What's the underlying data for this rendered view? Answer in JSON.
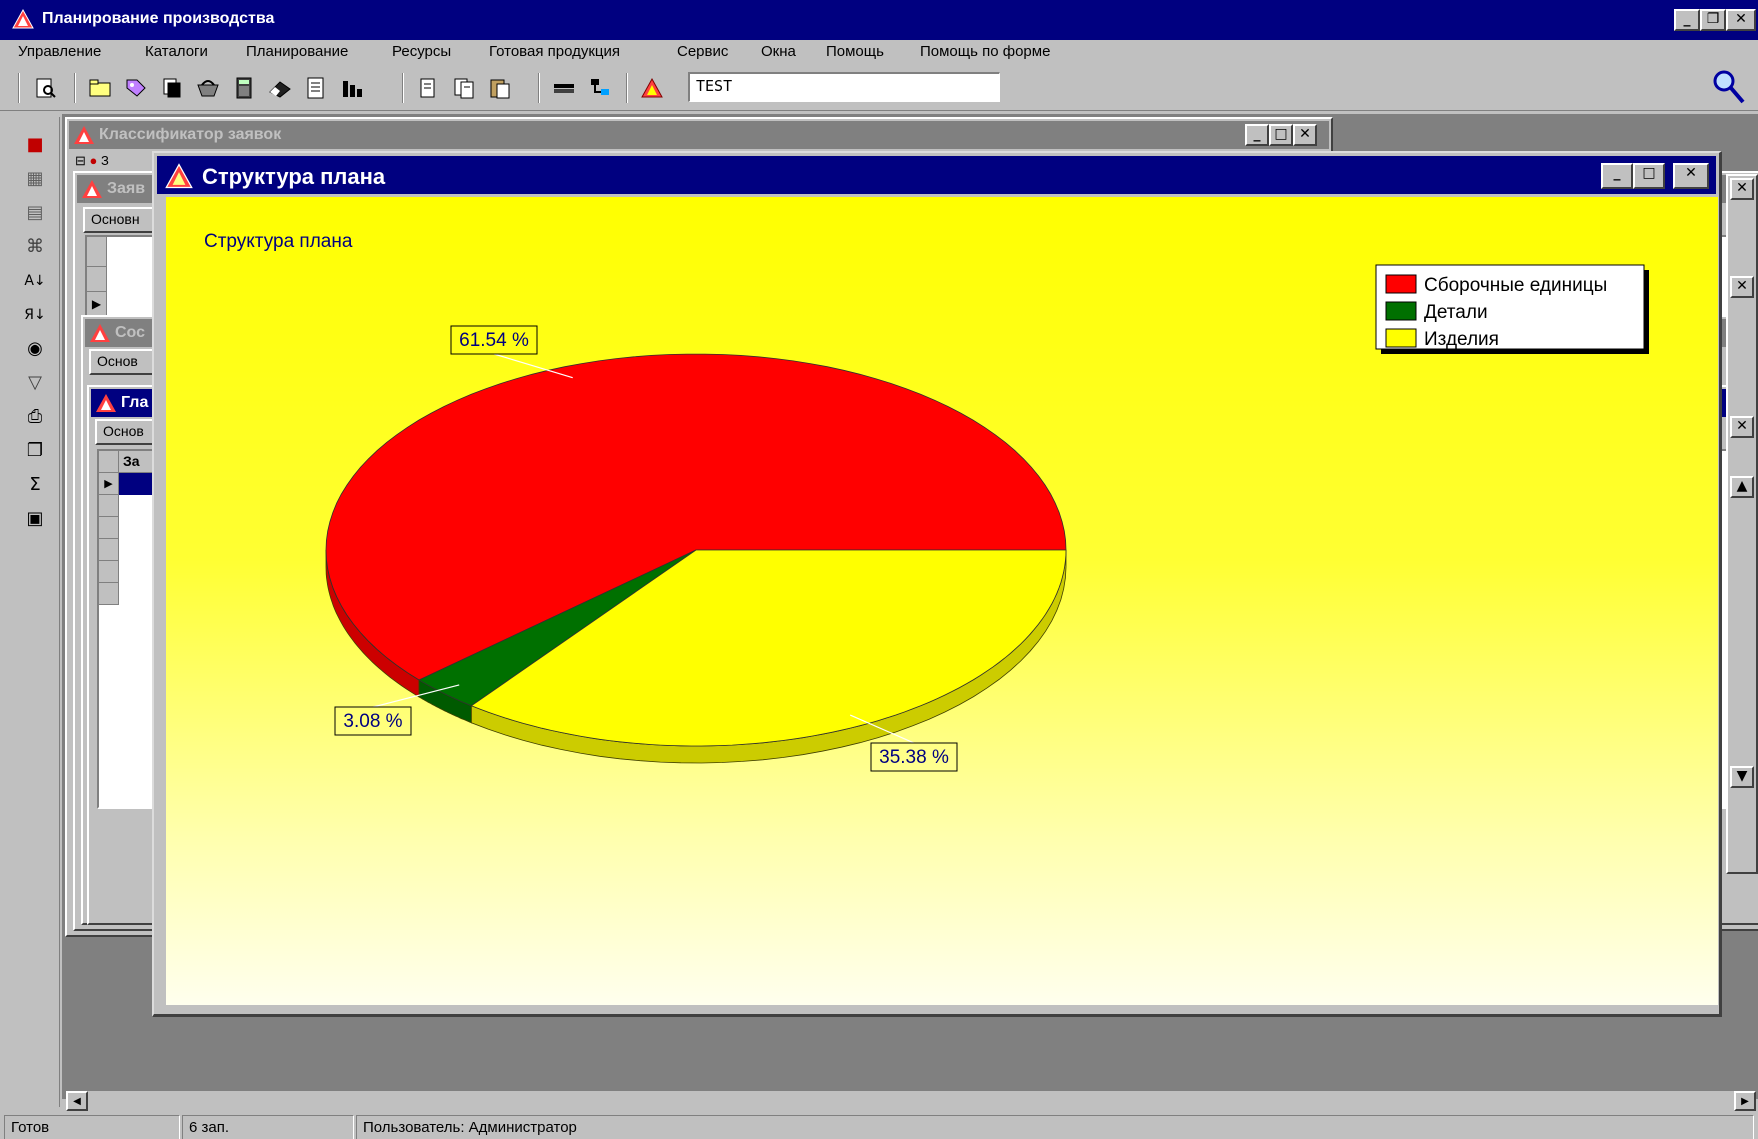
{
  "app": {
    "title": "Планирование производства"
  },
  "menu": [
    "Управление",
    "Каталоги",
    "Планирование",
    "Ресурсы",
    "Готовая продукция",
    "Сервис",
    "Окна",
    "Помощь",
    "Помощь по форме"
  ],
  "toolbar": {
    "search_value": "TEST",
    "icons": [
      "preview-icon",
      "folder-icon",
      "tag-icon",
      "copy-icon",
      "basket-icon",
      "calculator-icon",
      "eraser-icon",
      "document-icon",
      "chart-icon",
      "page-icon",
      "pages-icon",
      "paste-icon",
      "stack-icon",
      "tree-icon",
      "logo-icon",
      "search-icon"
    ]
  },
  "left_toolbar": {
    "icons": [
      "card-icon",
      "edit-icon",
      "form-icon",
      "link-icon",
      "sort-asc-icon",
      "sort-desc-icon",
      "binoculars-icon",
      "filter-icon",
      "print-icon",
      "preview-icon",
      "sum-icon",
      "save-icon"
    ]
  },
  "background": {
    "classifier_title": "Классификатор заявок",
    "tree_item": "З",
    "window2_title": "Заяв",
    "window2_tab": "Основн",
    "window3_title": "Сос",
    "window3_tab": "Основ",
    "window4_title": "Гла",
    "window4_tab": "Основ",
    "window4_column": "За"
  },
  "chart_window": {
    "title": "Структура плана"
  },
  "chart_data": {
    "type": "pie",
    "title": "Структура плана",
    "labels": [
      "Сборочные единицы",
      "Детали",
      "Изделия"
    ],
    "values": [
      61.54,
      3.08,
      35.38
    ],
    "value_labels": [
      "61.54 %",
      "3.08 %",
      "35.38 %"
    ],
    "colors": [
      "#ff0000",
      "#007000",
      "#ffff00"
    ],
    "style": "3d",
    "legend_position": "top-right"
  },
  "status": {
    "state": "Готов",
    "records": "6 зап.",
    "user": "Пользователь: Администратор"
  }
}
